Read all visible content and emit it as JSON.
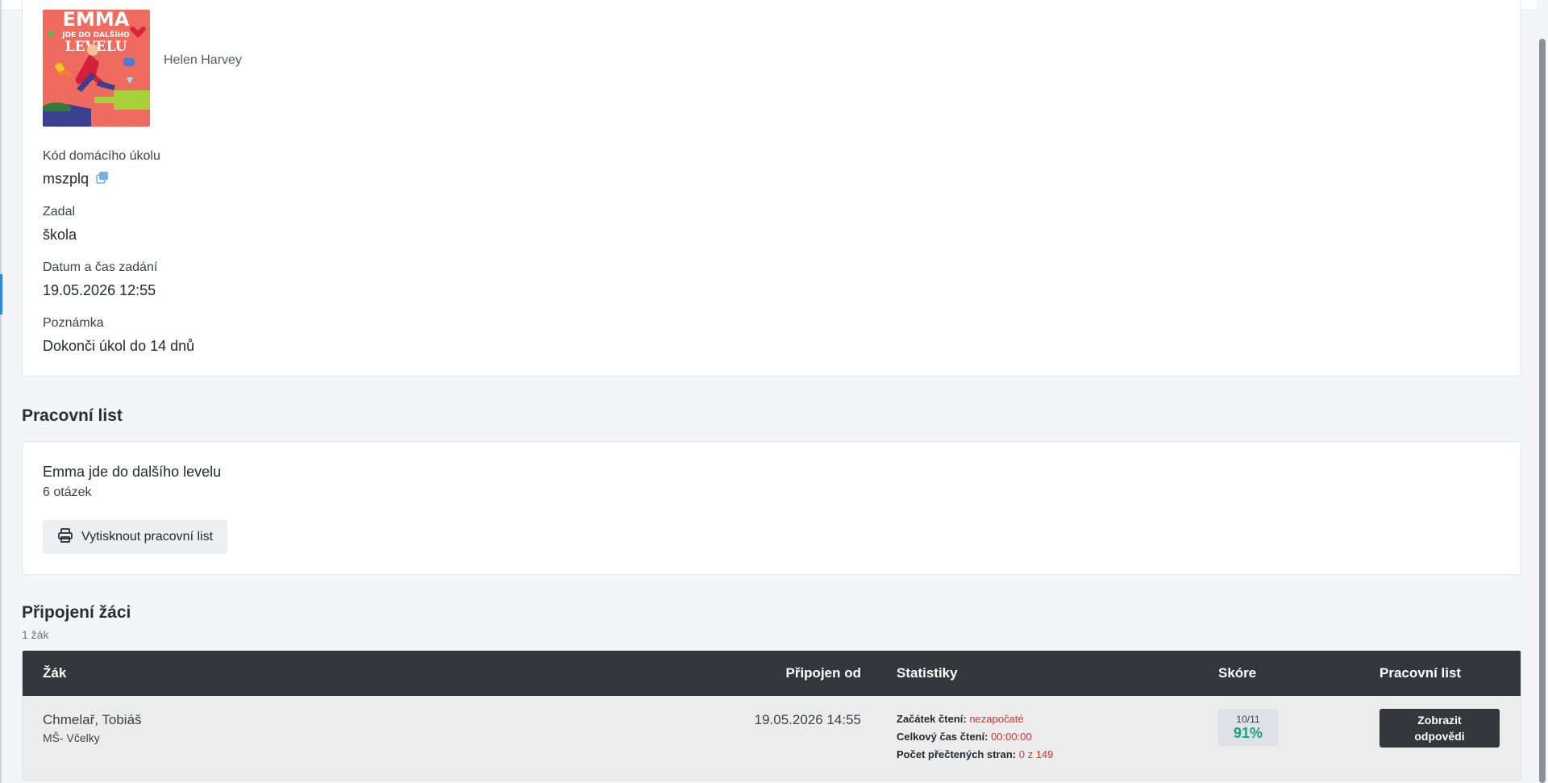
{
  "book": {
    "cover_title_line1": "EMMA",
    "cover_title_line2": "JDE DO DALŠÍHO",
    "cover_title_line3": "LEVELU",
    "author": "Helen Harvey"
  },
  "homework": {
    "code_label": "Kód domácího úkolu",
    "code_value": "mszplq",
    "assigned_by_label": "Zadal",
    "assigned_by_value": "škola",
    "datetime_label": "Datum a čas zadání",
    "datetime_value": "19.05.2026 12:55",
    "note_label": "Poznámka",
    "note_value": "Dokonči úkol do 14 dnů"
  },
  "worksheet": {
    "section_title": "Pracovní list",
    "title": "Emma jde do dalšího levelu",
    "question_count": "6 otázek",
    "print_label": "Vytisknout pracovní list"
  },
  "students": {
    "section_title": "Připojení žáci",
    "count": "1 žák",
    "columns": {
      "student": "Žák",
      "joined": "Připojen od",
      "stats": "Statistiky",
      "score": "Skóre",
      "worksheet": "Pracovní list"
    },
    "rows": [
      {
        "name": "Chmelař, Tobiáš",
        "class": "MŠ- Včelky",
        "joined": "19.05.2026 14:55",
        "start_label": "Začátek čtení:",
        "start_value": "nezapočaté",
        "time_label": "Celkový čas čtení:",
        "time_value": "00:00:00",
        "pages_label": "Počet přečtených stran:",
        "pages_value": "0 z 149",
        "score_fraction": "10/11",
        "score_percent": "91%",
        "answers_button": "Zobrazit odpovědi"
      }
    ]
  },
  "colors": {
    "accent": "#2f86e6",
    "header_dark": "#33373b",
    "warning_red": "#e0302a",
    "score_green": "#1aa37a"
  },
  "icons": [
    "copy-icon",
    "printer-icon"
  ]
}
